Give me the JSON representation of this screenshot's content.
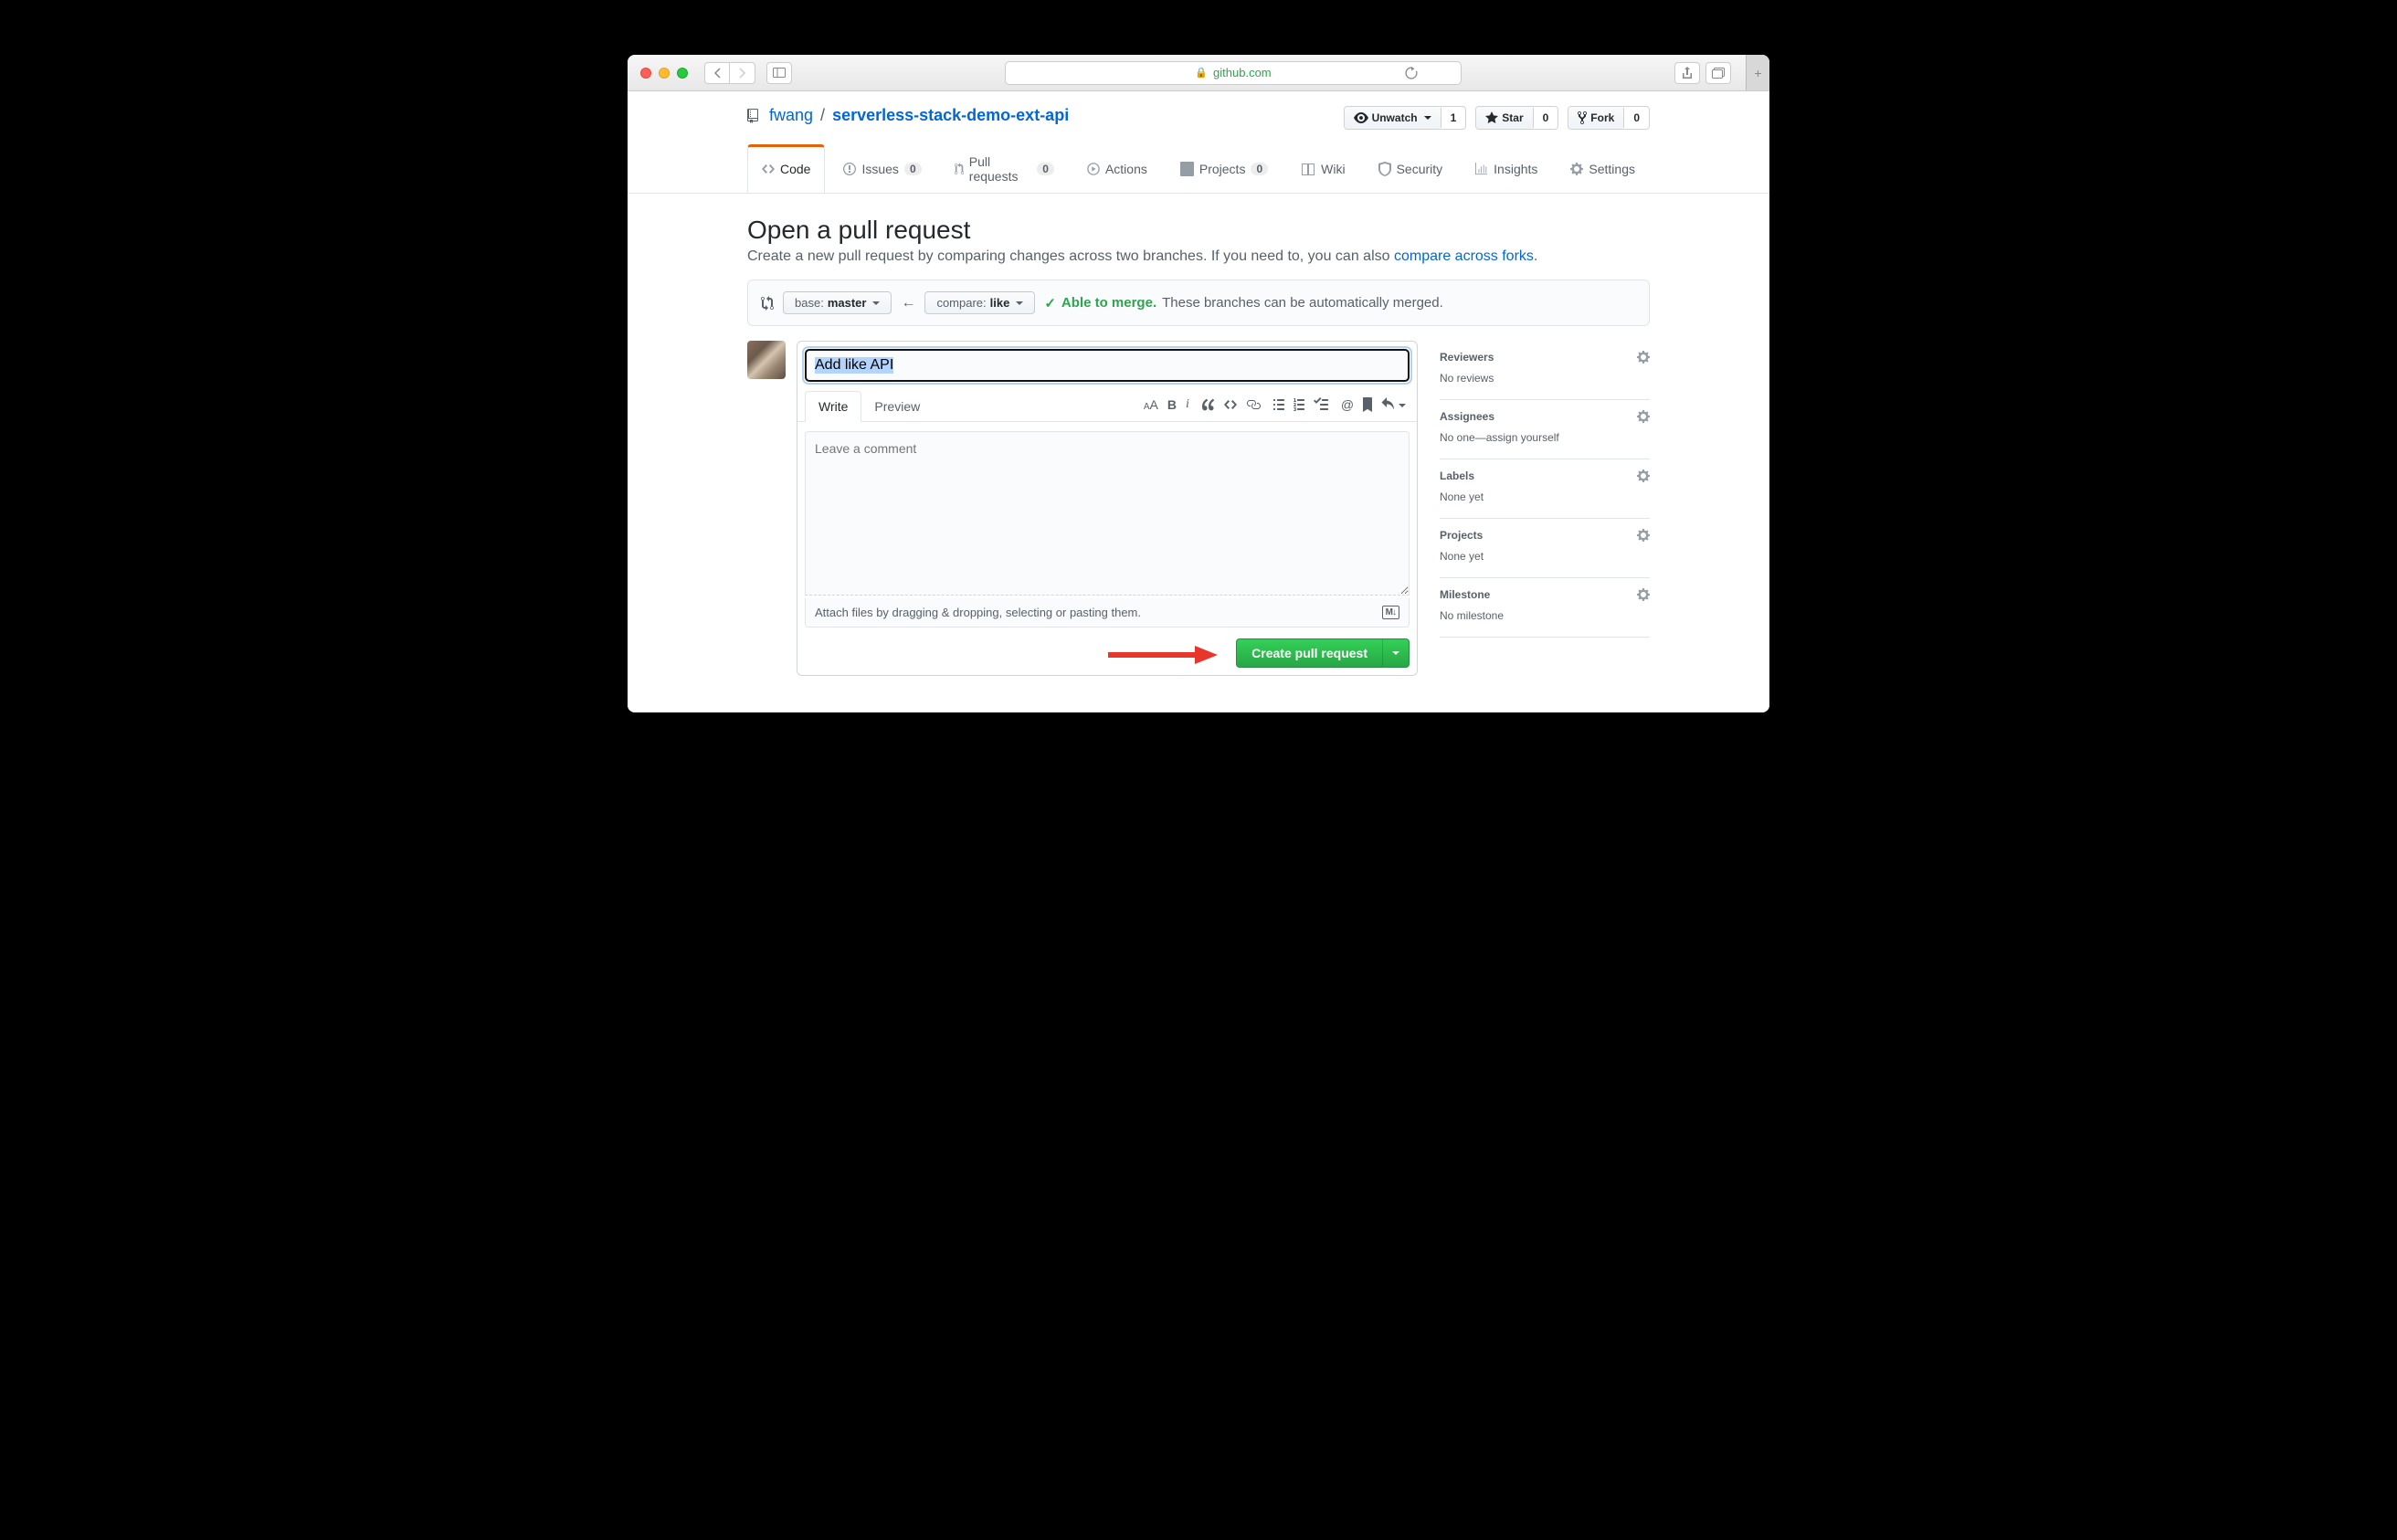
{
  "browser": {
    "domain": "github.com"
  },
  "repo": {
    "owner": "fwang",
    "name": "serverless-stack-demo-ext-api",
    "watch_label": "Unwatch",
    "watch_count": "1",
    "star_label": "Star",
    "star_count": "0",
    "fork_label": "Fork",
    "fork_count": "0"
  },
  "nav": {
    "code": "Code",
    "issues": "Issues",
    "issues_count": "0",
    "pulls": "Pull requests",
    "pulls_count": "0",
    "actions": "Actions",
    "projects": "Projects",
    "projects_count": "0",
    "wiki": "Wiki",
    "security": "Security",
    "insights": "Insights",
    "settings": "Settings"
  },
  "heading": {
    "title": "Open a pull request",
    "desc_pre": "Create a new pull request by comparing changes across two branches. If you need to, you can also ",
    "desc_link": "compare across forks",
    "desc_post": "."
  },
  "range": {
    "base_label": "base: ",
    "base_branch": "master",
    "compare_label": "compare: ",
    "compare_branch": "like",
    "merge_able": "Able to merge.",
    "merge_desc": "These branches can be automatically merged."
  },
  "form": {
    "title_value": "Add like API",
    "write_tab": "Write",
    "preview_tab": "Preview",
    "comment_placeholder": "Leave a comment",
    "attach_hint": "Attach files by dragging & dropping, selecting or pasting them.",
    "submit_label": "Create pull request"
  },
  "sidebar": {
    "reviewers_title": "Reviewers",
    "reviewers_body": "No reviews",
    "assignees_title": "Assignees",
    "assignees_body_pre": "No one—",
    "assignees_link": "assign yourself",
    "labels_title": "Labels",
    "labels_body": "None yet",
    "projects_title": "Projects",
    "projects_body": "None yet",
    "milestone_title": "Milestone",
    "milestone_body": "No milestone"
  }
}
